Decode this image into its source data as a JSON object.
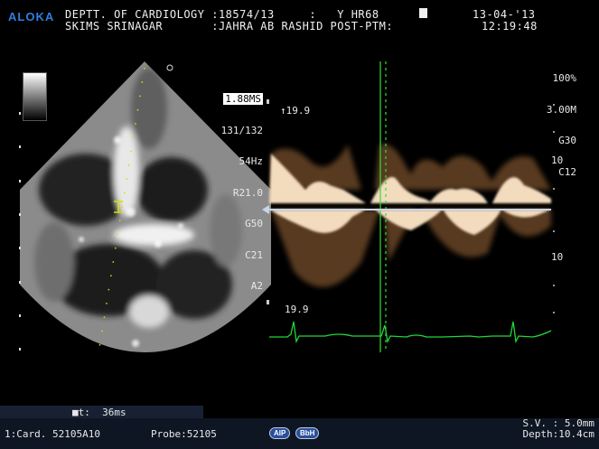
{
  "header": {
    "brand": "ALOKA",
    "line1": "DEPTT. OF CARDIOLOGY :18574/13     :   Y HR68",
    "line2": "SKIMS SRINAGAR       :JAHRA AB RASHID POST-PTM:",
    "date": "13-04-'13",
    "time": "12:19:48"
  },
  "params_left": [
    "1.88MS",
    "131/132",
    "54Hz",
    "R21.0",
    "G50",
    "C21",
    "A2"
  ],
  "params_right": [
    "100%",
    "3.00M",
    "G30",
    "C12"
  ],
  "doppler": {
    "scale_top": "↑19.9",
    "scale_bottom": "19.9",
    "tick_upper": "10",
    "tick_lower": "10"
  },
  "measure": {
    "label": "■t:  36ms"
  },
  "footer": {
    "card": "1:Card. 52105A10",
    "probe": "Probe:52105",
    "pill1": "AIP",
    "pill2": "BbH",
    "sv": "S.V. : 5.0mm",
    "depth": "Depth:10.4cm"
  },
  "colors": {
    "accent": "#2f7fe0",
    "ecg": "#22d63a",
    "cursor": "#2ee03a",
    "doppler": "#f2d8b4",
    "baseline": "#c8d4e8"
  }
}
